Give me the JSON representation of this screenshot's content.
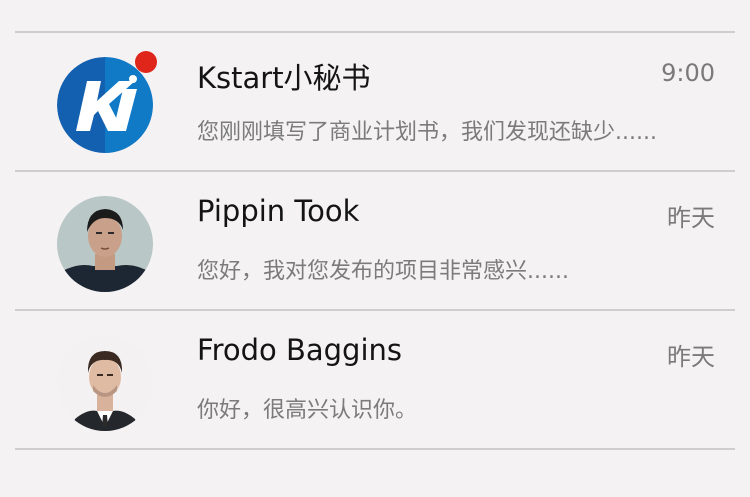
{
  "colors": {
    "background": "#f4f2f3",
    "divider": "#cfcdcd",
    "unread_badge": "#e0261a",
    "kstart_blue": "#1460b0"
  },
  "conversations": [
    {
      "name": "Kstart小秘书",
      "time": "9:00",
      "preview": "您刚刚填写了商业计划书，我们发现还缺少......",
      "avatar": "kstart-logo",
      "unread": true
    },
    {
      "name": "Pippin Took",
      "time": "昨天",
      "preview": "您好，我对您发布的项目非常感兴......",
      "avatar": "portrait-pippin",
      "unread": false
    },
    {
      "name": "Frodo Baggins",
      "time": "昨天",
      "preview": "你好，很高兴认识你。",
      "avatar": "portrait-frodo",
      "unread": false
    }
  ]
}
